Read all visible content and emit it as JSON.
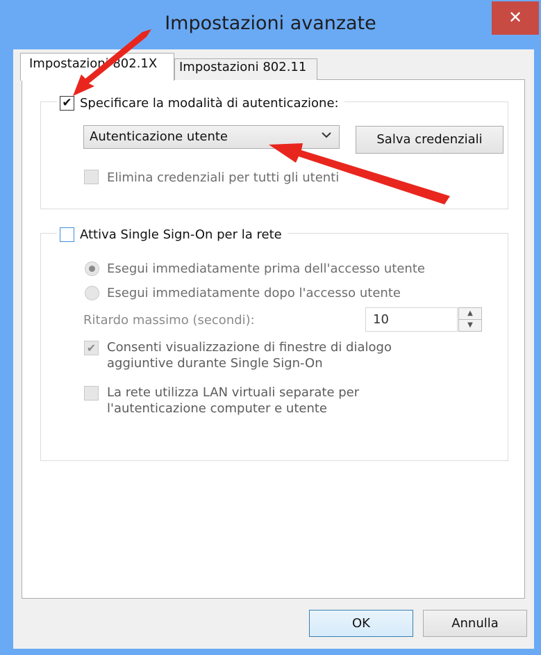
{
  "window": {
    "title": "Impostazioni avanzate",
    "close_glyph": "✕"
  },
  "tabs": [
    {
      "label": "Impostazioni 802.1X",
      "active": true
    },
    {
      "label": "Impostazioni 802.11",
      "active": false
    }
  ],
  "auth_group": {
    "checkbox_label": "Specificare la modalità di autenticazione:",
    "checked": true,
    "mode_selected": "Autenticazione utente",
    "save_button": "Salva credenziali",
    "delete_label": "Elimina credenziali per tutti gli utenti"
  },
  "sso_group": {
    "checkbox_label": "Attiva Single Sign-On per la rete",
    "checked": false,
    "radio_before": "Esegui immediatamente prima dell'accesso utente",
    "radio_after": "Esegui immediatamente dopo l'accesso utente",
    "delay_label": "Ritardo massimo (secondi):",
    "delay_value": "10",
    "allow_dialogs_line1": "Consenti visualizzazione di finestre di dialogo",
    "allow_dialogs_line2": "aggiuntive durante Single Sign-On",
    "vlan_line1": "La rete utilizza LAN virtuali separate per",
    "vlan_line2": "l'autenticazione computer e utente"
  },
  "footer": {
    "ok": "OK",
    "cancel": "Annulla"
  },
  "icons": {
    "check": "✔",
    "dropdown": "chevron-down-icon",
    "spin_up": "▲",
    "spin_down": "▼"
  },
  "colors": {
    "title_bar": "#6aaaf5",
    "close_button": "#c74b43",
    "annotation_arrow": "#e8261e"
  }
}
